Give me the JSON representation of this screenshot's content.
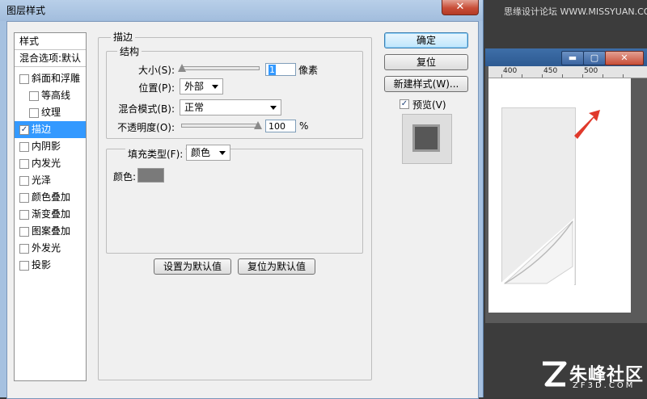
{
  "dialog": {
    "title": "图层样式",
    "close_label": "✕"
  },
  "style_list": {
    "header": "样式",
    "blend_options": "混合选项:默认",
    "items": [
      {
        "label": "斜面和浮雕",
        "checked": false,
        "indent": false
      },
      {
        "label": "等高线",
        "checked": false,
        "indent": true
      },
      {
        "label": "纹理",
        "checked": false,
        "indent": true
      },
      {
        "label": "描边",
        "checked": true,
        "indent": false,
        "selected": true
      },
      {
        "label": "内阴影",
        "checked": false,
        "indent": false
      },
      {
        "label": "内发光",
        "checked": false,
        "indent": false
      },
      {
        "label": "光泽",
        "checked": false,
        "indent": false
      },
      {
        "label": "颜色叠加",
        "checked": false,
        "indent": false
      },
      {
        "label": "渐变叠加",
        "checked": false,
        "indent": false
      },
      {
        "label": "图案叠加",
        "checked": false,
        "indent": false
      },
      {
        "label": "外发光",
        "checked": false,
        "indent": false
      },
      {
        "label": "投影",
        "checked": false,
        "indent": false
      }
    ]
  },
  "stroke": {
    "section_title": "描边",
    "structure_title": "结构",
    "size_label": "大小(S):",
    "size_value": "1",
    "size_fraction": 0.01,
    "size_unit": "像素",
    "position_label": "位置(P):",
    "position_value": "外部",
    "blend_mode_label": "混合模式(B):",
    "blend_mode_value": "正常",
    "opacity_label": "不透明度(O):",
    "opacity_value": "100",
    "opacity_fraction": 1.0,
    "opacity_unit": "%",
    "fill_type_label": "填充类型(F):",
    "fill_type_value": "颜色",
    "color_label": "颜色:",
    "color_value": "#7a7a7a"
  },
  "actions": {
    "make_default": "设置为默认值",
    "reset_default": "复位为默认值",
    "ok": "确定",
    "reset": "复位",
    "new_style": "新建样式(W)...",
    "preview_label": "预览(V)",
    "preview_checked": true
  },
  "background": {
    "watermark_top": "思缘设计论坛 WWW.MISSYUAN.COM",
    "ruler_ticks": [
      "400",
      "450",
      "500"
    ],
    "brand_cn": "朱峰社区",
    "brand_en": "ZF3D.COM",
    "arrow_color": "#e0392b",
    "window_buttons": [
      "▬",
      "▢",
      "✕"
    ]
  }
}
